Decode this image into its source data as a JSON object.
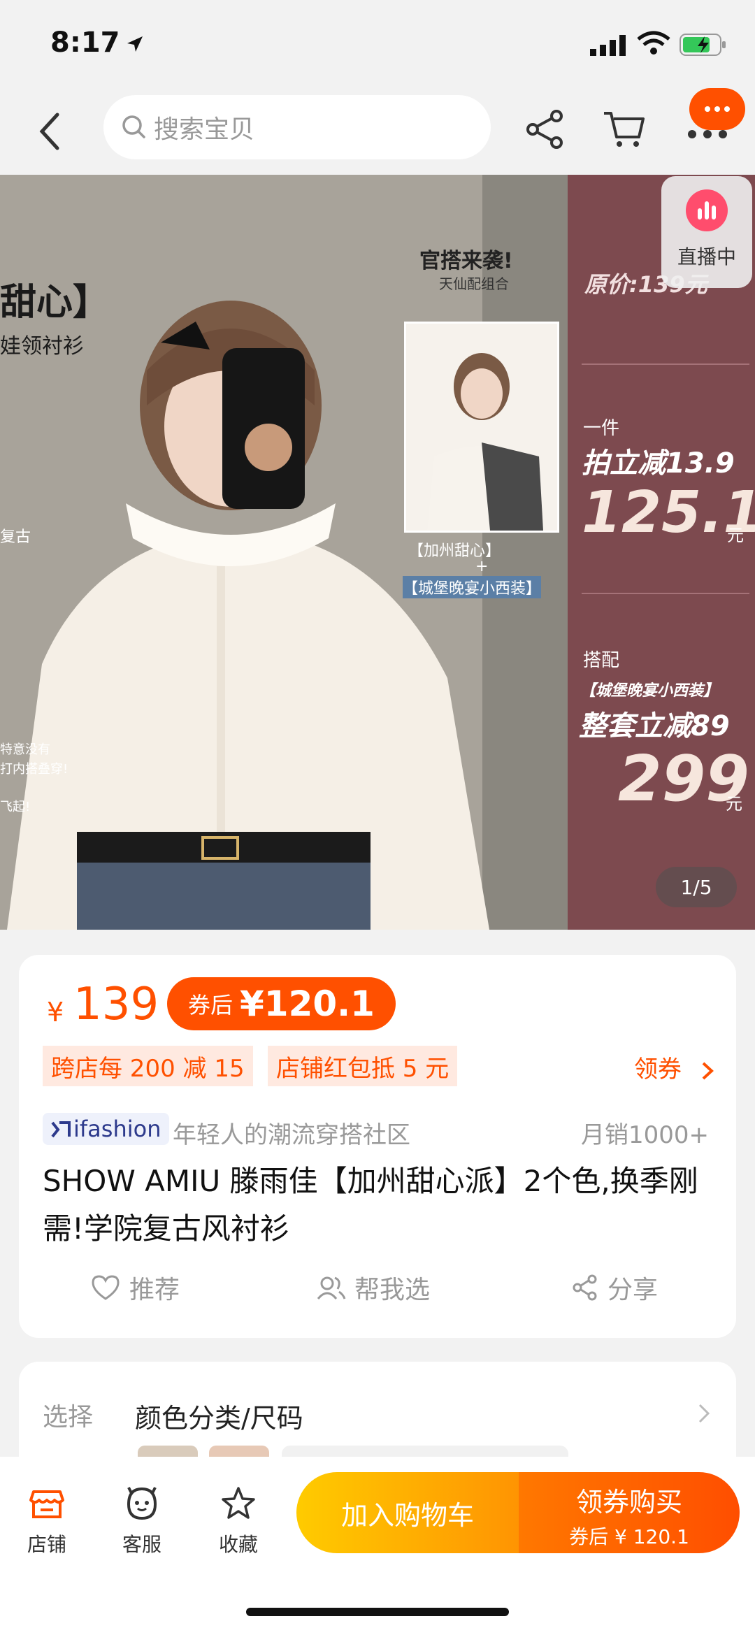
{
  "status_bar": {
    "time": "8:17"
  },
  "nav": {
    "search_placeholder": "搜索宝贝"
  },
  "hero": {
    "banner_left_title": "甜心】",
    "banner_left_sub": "娃领衬衫",
    "banner_left_note1": "复古",
    "banner_left_note2": "特意没有",
    "banner_left_note3": "打内搭叠穿!",
    "banner_left_note4": "飞起!",
    "combo_title": "官搭来袭!",
    "combo_sub": "天仙配组合",
    "combo_item1": "【加州甜心】",
    "combo_plus": "+",
    "combo_item2": "【城堡晚宴小西装】",
    "original_price": "原价:139元",
    "single_label": "一件",
    "single_discount": "拍立减13.9",
    "single_price": "125.1",
    "single_unit": "元",
    "set_label": "搭配",
    "set_item": "【城堡晚宴小西装】",
    "set_discount": "整套立减89",
    "set_price": "299",
    "set_unit": "元",
    "live_label": "直播中",
    "page_indicator": "1/5"
  },
  "product": {
    "currency": "¥",
    "price": "139",
    "coupon_label": "券后",
    "coupon_price": "¥120.1",
    "promo1": "跨店每 200 减 15",
    "promo2": "店铺红包抵 5 元",
    "get_coupon": "领券",
    "brand": "ifashion",
    "brand_desc": "年轻人的潮流穿搭社区",
    "monthly_sales": "月销1000+",
    "title": "SHOW AMIU 滕雨佳【加州甜心派】2个色,换季刚需!学院复古风衬衫",
    "actions": {
      "recommend": "推荐",
      "help_choose": "帮我选",
      "share": "分享"
    }
  },
  "options": {
    "label": "选择",
    "value": "颜色分类/尺码"
  },
  "bottom_bar": {
    "shop": "店铺",
    "service": "客服",
    "favorite": "收藏",
    "add_cart": "加入购物车",
    "buy_main": "领券购买",
    "buy_sub": "券后 ¥ 120.1"
  },
  "colors": {
    "accent": "#ff5000",
    "panel": "#7d4a4f"
  }
}
